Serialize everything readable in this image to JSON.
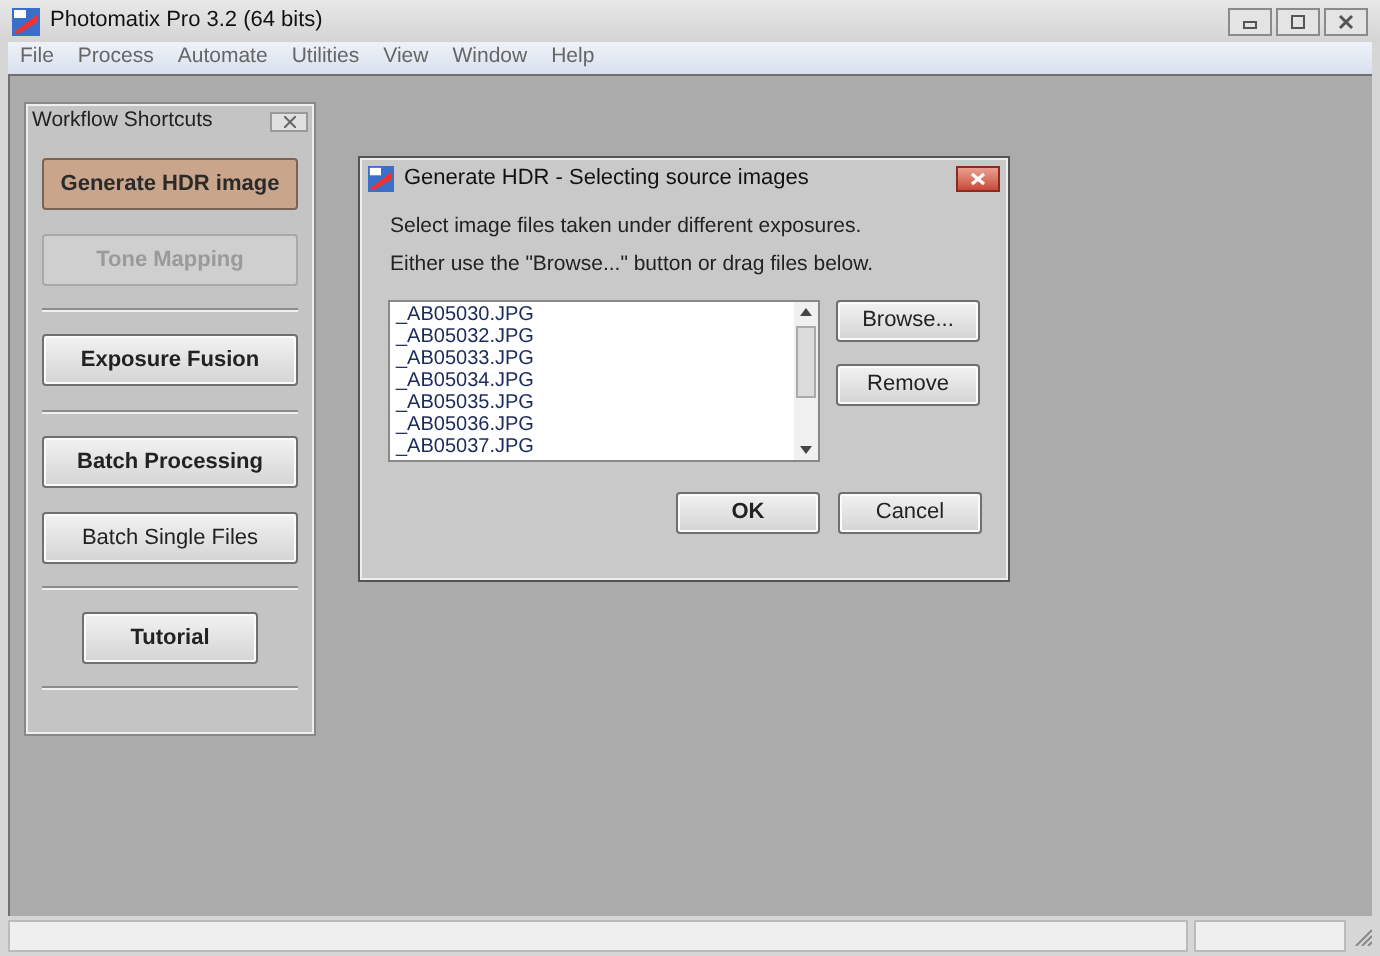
{
  "window": {
    "title": "Photomatix Pro 3.2 (64 bits)"
  },
  "menu": [
    "File",
    "Process",
    "Automate",
    "Utilities",
    "View",
    "Window",
    "Help"
  ],
  "shortcuts": {
    "title": "Workflow Shortcuts",
    "items": [
      {
        "kind": "highlighted",
        "label": "Generate HDR image"
      },
      {
        "kind": "disabled",
        "label": "Tone Mapping"
      },
      {
        "kind": "divider"
      },
      {
        "kind": "bold",
        "label": "Exposure Fusion"
      },
      {
        "kind": "divider"
      },
      {
        "kind": "bold",
        "label": "Batch Processing"
      },
      {
        "kind": "plain",
        "label": "Batch Single Files"
      },
      {
        "kind": "divider"
      },
      {
        "kind": "small",
        "label": "Tutorial"
      },
      {
        "kind": "divider"
      }
    ]
  },
  "dialog": {
    "title": "Generate HDR - Selecting source images",
    "instructions": [
      "Select image files taken under different exposures.",
      "Either use the \"Browse...\" button or drag files below."
    ],
    "files": [
      "_AB05030.JPG",
      "_AB05032.JPG",
      "_AB05033.JPG",
      "_AB05034.JPG",
      "_AB05035.JPG",
      "_AB05036.JPG",
      "_AB05037.JPG"
    ],
    "side_buttons": [
      "Browse...",
      "Remove"
    ],
    "ok": "OK",
    "cancel": "Cancel"
  }
}
